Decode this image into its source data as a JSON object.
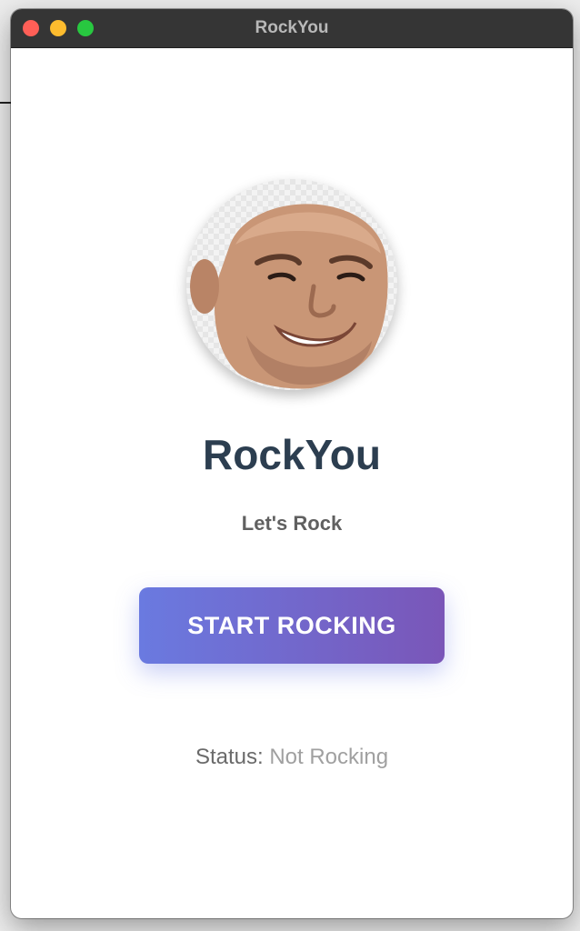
{
  "window": {
    "title": "RockYou"
  },
  "main": {
    "avatar_icon": "portrait-avatar",
    "title": "RockYou",
    "subtitle": "Let's Rock",
    "start_button_label": "START ROCKING",
    "status_label": "Status:",
    "status_value": "Not Rocking"
  },
  "colors": {
    "titlebar": "#353535",
    "title_text": "#2c3e50",
    "button_gradient_start": "#6a7ae0",
    "button_gradient_end": "#7a56b8",
    "status_value": "#a0a0a0"
  }
}
